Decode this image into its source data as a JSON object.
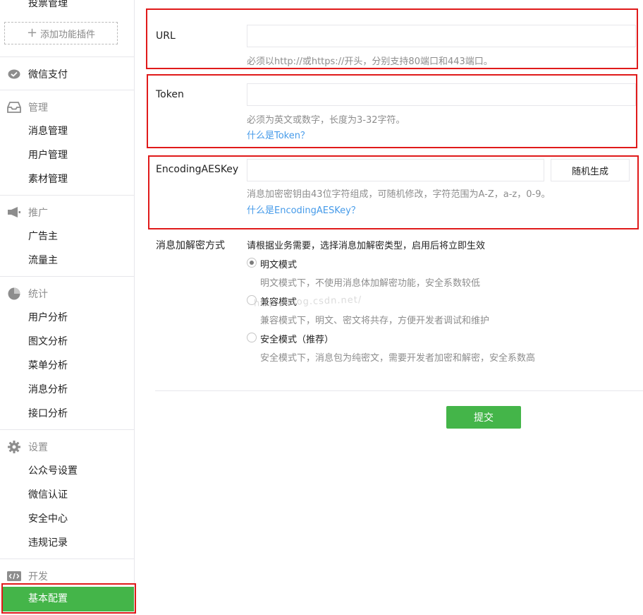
{
  "sidebar": {
    "cut_item": "投票管理",
    "add_plugin": "添加功能插件",
    "wechat_pay": "微信支付",
    "manage": {
      "title": "管理",
      "items": [
        "消息管理",
        "用户管理",
        "素材管理"
      ]
    },
    "promote": {
      "title": "推广",
      "items": [
        "广告主",
        "流量主"
      ]
    },
    "stats": {
      "title": "统计",
      "items": [
        "用户分析",
        "图文分析",
        "菜单分析",
        "消息分析",
        "接口分析"
      ]
    },
    "settings": {
      "title": "设置",
      "items": [
        "公众号设置",
        "微信认证",
        "安全中心",
        "违规记录"
      ]
    },
    "dev": {
      "title": "开发",
      "active_item": "基本配置"
    }
  },
  "form": {
    "url": {
      "label": "URL",
      "value": "",
      "hint": "必须以http://或https://开头，分别支持80端口和443端口。"
    },
    "token": {
      "label": "Token",
      "value": "",
      "hint": "必须为英文或数字，长度为3-32字符。",
      "link": "什么是Token？"
    },
    "aeskey": {
      "label": "EncodingAESKey",
      "value": "",
      "random_button": "随机生成",
      "hint": "消息加密密钥由43位字符组成，可随机修改，字符范围为A-Z，a-z，0-9。",
      "link": "什么是EncodingAESKey？"
    },
    "encrypt": {
      "label": "消息加解密方式",
      "intro": "请根据业务需要，选择消息加解密类型，启用后将立即生效",
      "options": [
        {
          "label": "明文模式",
          "desc": "明文模式下，不使用消息体加解密功能，安全系数较低",
          "checked": true
        },
        {
          "label": "兼容模式",
          "desc": "兼容模式下，明文、密文将共存，方便开发者调试和维护",
          "checked": false
        },
        {
          "label": "安全模式（推荐）",
          "desc": "安全模式下，消息包为纯密文，需要开发者加密和解密，安全系数高",
          "checked": false
        }
      ]
    },
    "submit": "提交",
    "watermark": "http://blog.csdn.net/"
  },
  "colors": {
    "accent_green": "#44b549",
    "link_blue": "#459ae9",
    "highlight_red": "#e01a1a"
  }
}
